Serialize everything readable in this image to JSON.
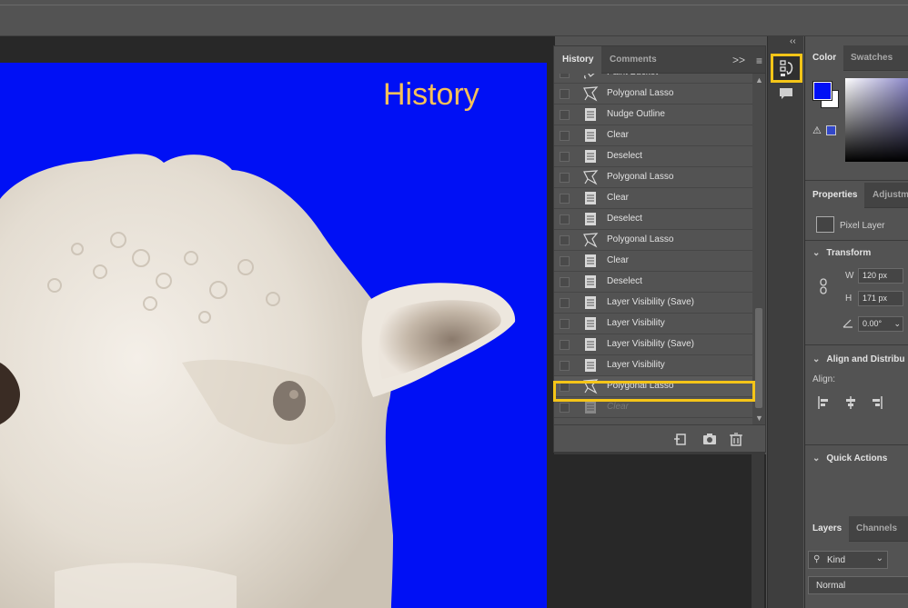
{
  "canvas": {
    "title": "History",
    "background_color": "#0010f5",
    "title_color": "#f5c05a"
  },
  "history_panel": {
    "tabs": [
      "History",
      "Comments"
    ],
    "items": [
      {
        "label": "Paint Bucket",
        "icon": "paint-bucket-icon"
      },
      {
        "label": "Polygonal Lasso",
        "icon": "polygonal-lasso-icon"
      },
      {
        "label": "Nudge Outline",
        "icon": "document-icon"
      },
      {
        "label": "Clear",
        "icon": "document-icon"
      },
      {
        "label": "Deselect",
        "icon": "document-icon"
      },
      {
        "label": "Polygonal Lasso",
        "icon": "polygonal-lasso-icon"
      },
      {
        "label": "Clear",
        "icon": "document-icon"
      },
      {
        "label": "Deselect",
        "icon": "document-icon"
      },
      {
        "label": "Polygonal Lasso",
        "icon": "polygonal-lasso-icon"
      },
      {
        "label": "Clear",
        "icon": "document-icon"
      },
      {
        "label": "Deselect",
        "icon": "document-icon"
      },
      {
        "label": "Layer Visibility (Save)",
        "icon": "document-icon"
      },
      {
        "label": "Layer Visibility",
        "icon": "document-icon"
      },
      {
        "label": "Layer Visibility (Save)",
        "icon": "document-icon"
      },
      {
        "label": "Layer Visibility",
        "icon": "document-icon"
      },
      {
        "label": "Polygonal Lasso",
        "icon": "polygonal-lasso-icon",
        "selected": true
      },
      {
        "label": "Clear",
        "icon": "document-icon",
        "dimmed": true
      }
    ],
    "footer_icons": [
      "new-document-from-state-icon",
      "camera-icon",
      "trash-icon"
    ],
    "highlight_color": "#f5c518"
  },
  "right_dock": {
    "color_tabs": [
      "Color",
      "Swatches"
    ],
    "foreground_color": "#0010f5",
    "background_color": "#ffffff",
    "properties_tabs": [
      "Properties",
      "Adjustm"
    ],
    "layer_type": "Pixel Layer",
    "transform": {
      "title": "Transform",
      "w_label": "W",
      "w_value": "120 px",
      "h_label": "H",
      "h_value": "171 px",
      "angle_value": "0.00°"
    },
    "align": {
      "title": "Align and Distribu",
      "label": "Align:"
    },
    "quick_actions": "Quick Actions",
    "layers_tabs": [
      "Layers",
      "Channels"
    ],
    "kind_filter": "Kind",
    "blend_mode": "Normal"
  }
}
